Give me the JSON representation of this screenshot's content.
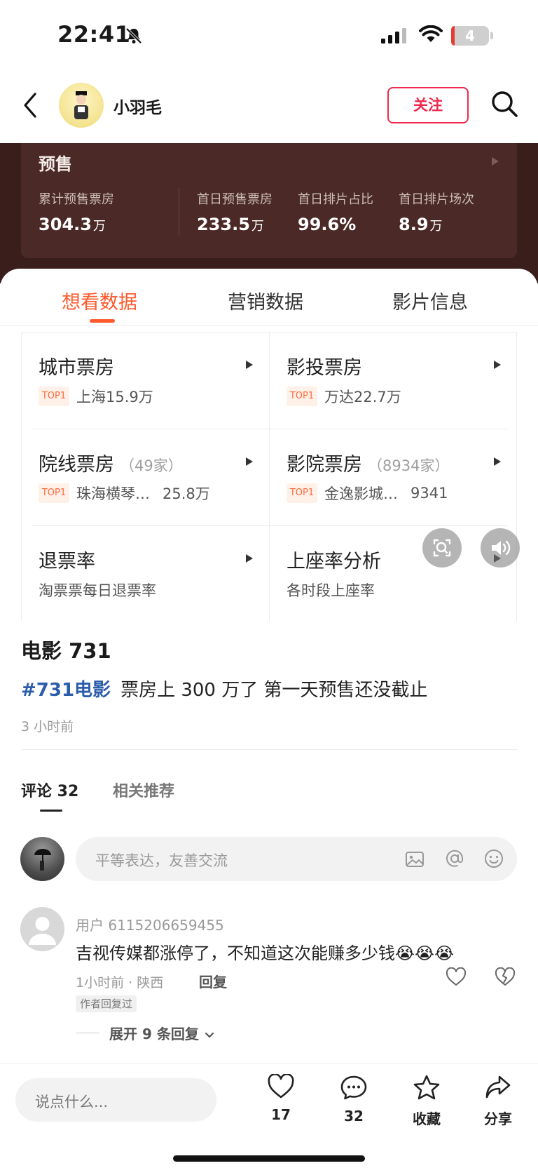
{
  "status": {
    "time": "22:41",
    "battery": "4"
  },
  "header": {
    "author": "小羽毛",
    "follow_label": "关注"
  },
  "presale": {
    "title": "预售",
    "stats": [
      {
        "label": "累计预售票房",
        "value": "304.3",
        "unit": "万"
      },
      {
        "label": "首日预售票房",
        "value": "233.5",
        "unit": "万"
      },
      {
        "label": "首日排片占比",
        "value": "99.6%",
        "unit": ""
      },
      {
        "label": "首日排片场次",
        "value": "8.9",
        "unit": "万"
      }
    ]
  },
  "tabs": [
    "想看数据",
    "营销数据",
    "影片信息"
  ],
  "grid": {
    "badge": "TOP1",
    "cells": [
      {
        "title": "城市票房",
        "count": "",
        "name": "上海15.9万",
        "num": ""
      },
      {
        "title": "影投票房",
        "count": "",
        "name": "万达22.7万",
        "num": ""
      },
      {
        "title": "院线票房",
        "count": "（49家）",
        "name": "珠海横琴…",
        "num": "25.8万"
      },
      {
        "title": "影院票房",
        "count": "（8934家）",
        "name": "金逸影城…",
        "num": "9341"
      },
      {
        "title": "退票率",
        "sub": "淘票票每日退票率"
      },
      {
        "title": "上座率分析",
        "sub": "各时段上座率"
      }
    ]
  },
  "post": {
    "title": "电影 731",
    "tag": "#731电影",
    "text": "票房上 300 万了 第一天预售还没截止",
    "time": "3 小时前"
  },
  "comments": {
    "tab_comments": "评论 32",
    "tab_related": "相关推荐",
    "input_placeholder": "平等表达，友善交流",
    "items": [
      {
        "user": "用户 6115206659455",
        "text": "吉视传媒都涨停了，不知道这次能赚多少钱😭😭😭",
        "meta": "1小时前 · 陕西",
        "reply": "回复",
        "badge": "作者回复过",
        "expand": "展开 9 条回复"
      }
    ]
  },
  "bottom": {
    "say_placeholder": "说点什么...",
    "like_count": "17",
    "comment_count": "32",
    "collect_label": "收藏",
    "share_label": "分享"
  }
}
